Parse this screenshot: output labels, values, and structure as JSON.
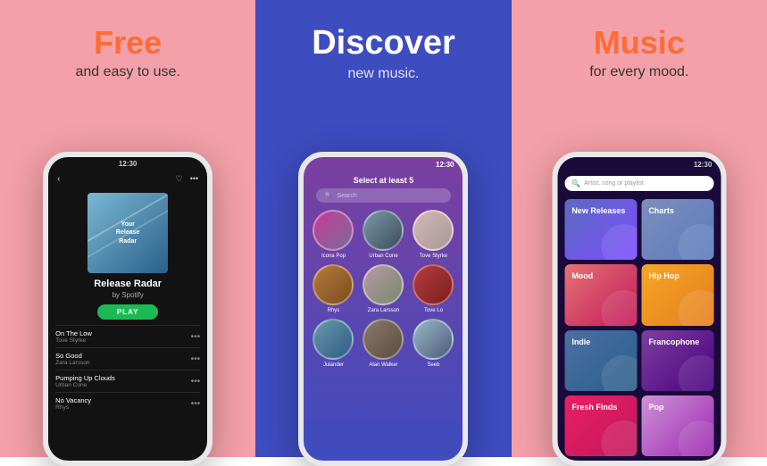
{
  "panels": [
    {
      "id": "left",
      "title": "Free",
      "subtitle": "and easy to use.",
      "bg": "#f4a0a8"
    },
    {
      "id": "middle",
      "title": "Discover",
      "subtitle": "new music.",
      "bg": "#3d4cbf"
    },
    {
      "id": "right",
      "title": "Music",
      "subtitle": "for every mood.",
      "bg": "#f4a0a8"
    }
  ],
  "left_phone": {
    "status_time": "12:30",
    "album_title": "Release Radar",
    "album_subtitle": "by Spotify",
    "album_label_line1": "Your",
    "album_label_line2": "Release",
    "album_label_line3": "Radar",
    "play_label": "PLAY",
    "tracks": [
      {
        "name": "On The Low",
        "artist": "Tove Styrke"
      },
      {
        "name": "So Good",
        "artist": "Zara Larsson"
      },
      {
        "name": "Pumping Up Clouds",
        "artist": "Urban Cone"
      },
      {
        "name": "No Vacancy",
        "artist": "Rhys"
      }
    ]
  },
  "middle_phone": {
    "status_time": "12:30",
    "prompt": "Select at least 5",
    "search_placeholder": "Search",
    "artists": [
      {
        "name": "Icona Pop"
      },
      {
        "name": "Urban Cone"
      },
      {
        "name": "Tove Styrke"
      },
      {
        "name": "Rhys"
      },
      {
        "name": "Zara Larsson"
      },
      {
        "name": "Tove Lo"
      },
      {
        "name": "Julander"
      },
      {
        "name": "Alan Walker"
      },
      {
        "name": "Seeb"
      }
    ]
  },
  "right_phone": {
    "status_time": "12:30",
    "search_placeholder": "Artist, song or playlist",
    "genres": [
      {
        "name": "New Releases",
        "tile": "new-releases"
      },
      {
        "name": "Charts",
        "tile": "charts"
      },
      {
        "name": "Mood",
        "tile": "mood"
      },
      {
        "name": "Hip Hop",
        "tile": "hiphop"
      },
      {
        "name": "Indie",
        "tile": "indie"
      },
      {
        "name": "Francophone",
        "tile": "francophone"
      },
      {
        "name": "Fresh Finds",
        "tile": "fresh"
      },
      {
        "name": "Pop",
        "tile": "pop"
      }
    ]
  }
}
